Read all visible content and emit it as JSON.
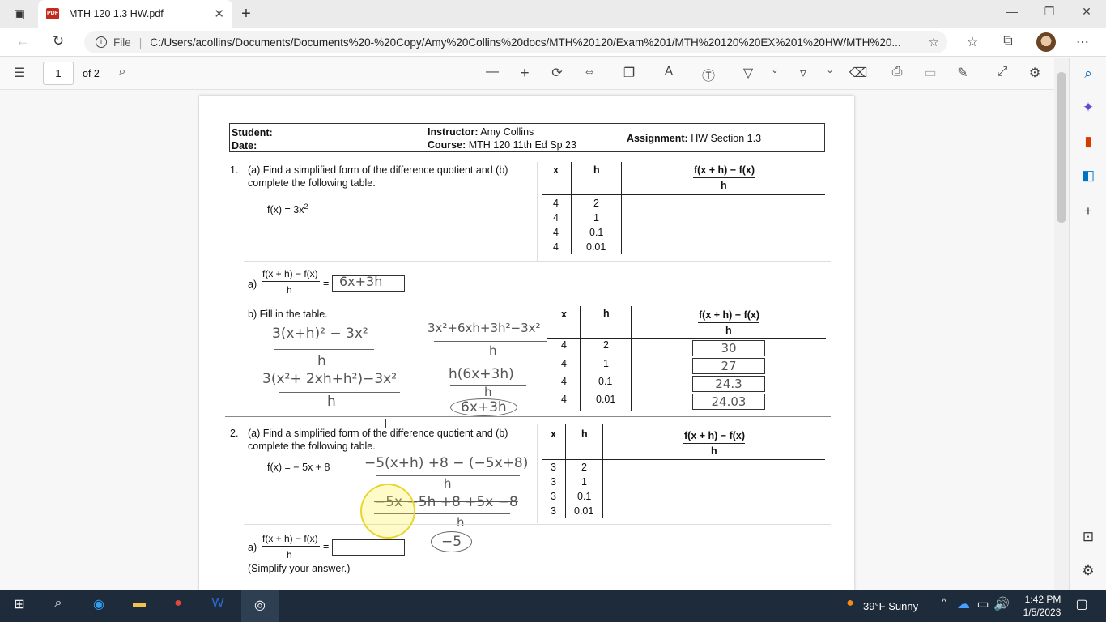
{
  "browser": {
    "tab_title": "MTH 120 1.3 HW.pdf",
    "new_tab": "+",
    "url_scheme": "File",
    "url": "C:/Users/acollins/Documents/Documents%20-%20Copy/Amy%20Collins%20docs/MTH%20120/Exam%201/MTH%20120%20EX%201%20HW/MTH%20..."
  },
  "pdf_toolbar": {
    "page_current": "1",
    "page_total": "of 2"
  },
  "header": {
    "student_label": "Student:",
    "date_label": "Date:",
    "instructor_label": "Instructor:",
    "instructor": "Amy Collins",
    "course_label": "Course:",
    "course": "MTH 120 11th Ed Sp 23",
    "assignment_label": "Assignment:",
    "assignment": "HW Section 1.3"
  },
  "problem1": {
    "number": "1.",
    "text1": "(a) Find a simplified form of the difference quotient and (b)",
    "text2": "complete the following table.",
    "func": "f(x) = 3x",
    "exp": "2",
    "table": {
      "col_x": "x",
      "col_h": "h",
      "col_q_num": "f(x + h) − f(x)",
      "col_q_den": "h",
      "rows": [
        {
          "x": "4",
          "h": "2"
        },
        {
          "x": "4",
          "h": "1"
        },
        {
          "x": "4",
          "h": "0.1"
        },
        {
          "x": "4",
          "h": "0.01"
        }
      ]
    },
    "a_label": "a)",
    "q_num": "f(x + h) − f(x)",
    "q_den": "h",
    "equals": "=",
    "a_answer": "6x+3h",
    "b_label": "b) Fill in the table.",
    "table_b": {
      "col_x": "x",
      "col_h": "h",
      "col_q_num": "f(x + h) − f(x)",
      "col_q_den": "h",
      "rows": [
        {
          "x": "4",
          "h": "2",
          "v": "30"
        },
        {
          "x": "4",
          "h": "1",
          "v": "27"
        },
        {
          "x": "4",
          "h": "0.1",
          "v": "24.3"
        },
        {
          "x": "4",
          "h": "0.01",
          "v": "24.03"
        }
      ]
    },
    "work": {
      "l1": "3(x+h)² − 3x²",
      "l1d": "h",
      "l2": "3(x²+ 2xh+h²)−3x²",
      "l2d": "h",
      "r1": "3x²+6xh+3h²−3x²",
      "r1d": "h",
      "r2": "h(6x+3h)",
      "r2d": "h",
      "r3": "6x+3h"
    }
  },
  "problem2": {
    "number": "2.",
    "text1": "(a) Find a simplified form of the difference quotient and (b)",
    "text2": "complete the following table.",
    "func": "f(x) = − 5x + 8",
    "table": {
      "col_x": "x",
      "col_h": "h",
      "col_q_num": "f(x + h) − f(x)",
      "col_q_den": "h",
      "rows": [
        {
          "x": "3",
          "h": "2"
        },
        {
          "x": "3",
          "h": "1"
        },
        {
          "x": "3",
          "h": "0.1"
        },
        {
          "x": "3",
          "h": "0.01"
        }
      ]
    },
    "work": {
      "w1": "−5(x+h) +8 − (−5x+8)",
      "w1d": "h",
      "w2": "−5x −5h +8 +5x −8",
      "w2d": "h",
      "w3": "−5"
    },
    "a_label": "a)",
    "q_num": "f(x + h) − f(x)",
    "q_den": "h",
    "equals": "=",
    "note": "(Simplify your answer.)"
  },
  "taskbar": {
    "weather": "39°F  Sunny",
    "time": "1:42 PM",
    "date": "1/5/2023"
  },
  "colors": {
    "taskbar": "#1e2b3a",
    "pdf_icon": "#c42b1c"
  }
}
